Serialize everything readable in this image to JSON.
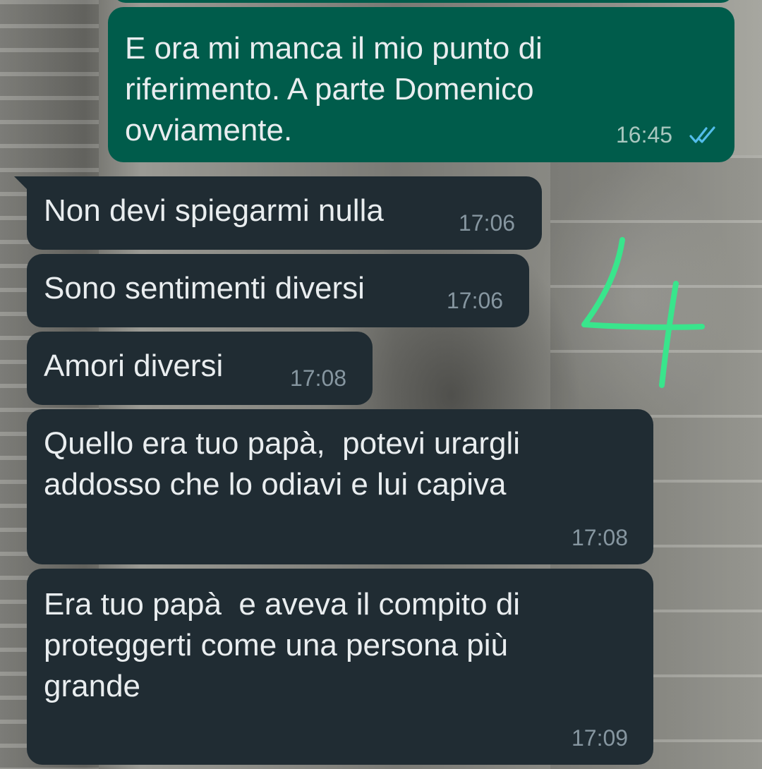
{
  "messages": [
    {
      "direction": "outgoing",
      "text": "E ora mi manca il mio punto di\nriferimento. A parte Domenico\novviamente.",
      "time": "16:45",
      "status": "read-double-check"
    },
    {
      "direction": "incoming",
      "text": "Non devi spiegarmi nulla",
      "time": "17:06"
    },
    {
      "direction": "incoming",
      "text": "Sono sentimenti diversi",
      "time": "17:06"
    },
    {
      "direction": "incoming",
      "text": "Amori diversi",
      "time": "17:08"
    },
    {
      "direction": "incoming",
      "text": "Quello era tuo papà,  potevi urargli\naddosso che lo odiavi e lui capiva",
      "time": "17:08"
    },
    {
      "direction": "incoming",
      "text": "Era tuo papà  e aveva il compito di\nproteggerti come una persona più\ngrande",
      "time": "17:09"
    }
  ],
  "annotation": {
    "text": "4",
    "color": "#39e58c"
  },
  "colors": {
    "outgoing_bubble": "#005c4b",
    "incoming_bubble": "#202c33",
    "read_tick": "#53bdeb"
  }
}
